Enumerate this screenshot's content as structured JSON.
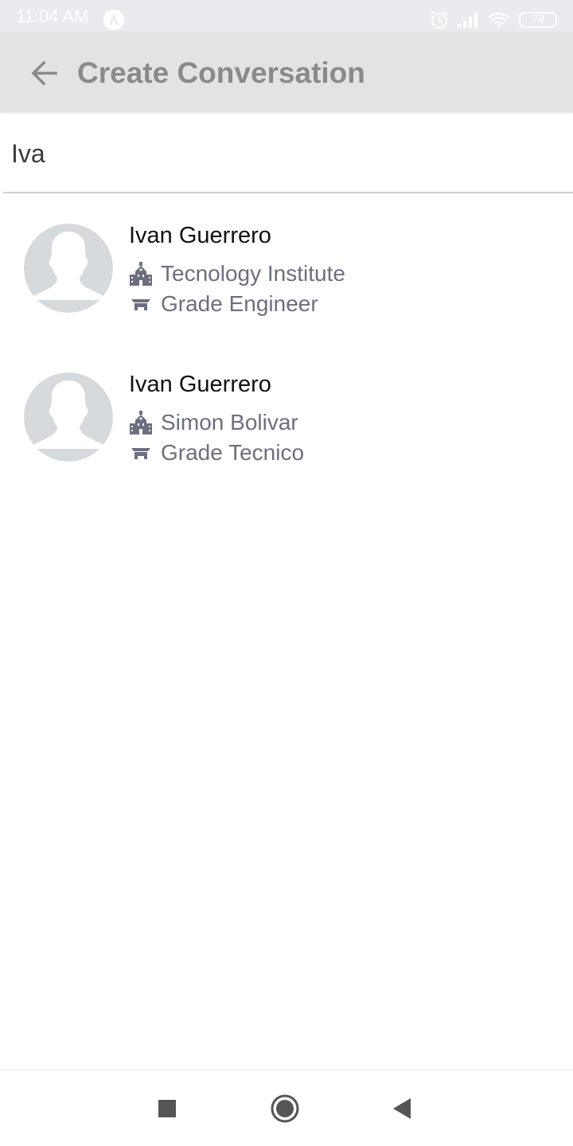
{
  "status_bar": {
    "time": "11:04 AM",
    "battery": "74",
    "icons": [
      "app-notification-icon",
      "alarm-icon",
      "signal-icon",
      "wifi-icon",
      "battery-icon"
    ]
  },
  "app_bar": {
    "title": "Create Conversation",
    "back_icon": "arrow-left-icon"
  },
  "search": {
    "value": "Iva"
  },
  "results": [
    {
      "name": "Ivan Guerrero",
      "institution": "Tecnology Institute",
      "grade": "Grade Engineer"
    },
    {
      "name": "Ivan Guerrero",
      "institution": "Simon Bolivar",
      "grade": "Grade Tecnico"
    }
  ],
  "nav_bar": {
    "icons": [
      "recents-square-icon",
      "home-circle-icon",
      "back-triangle-icon"
    ]
  },
  "colors": {
    "status_bar_bg": "#eaeaef",
    "app_bar_bg": "#e3e3e3",
    "title_color": "#8a8a8a",
    "meta_text": "#6b6f80",
    "icon_color": "#6b6f80",
    "avatar_bg": "#d6dadd"
  }
}
